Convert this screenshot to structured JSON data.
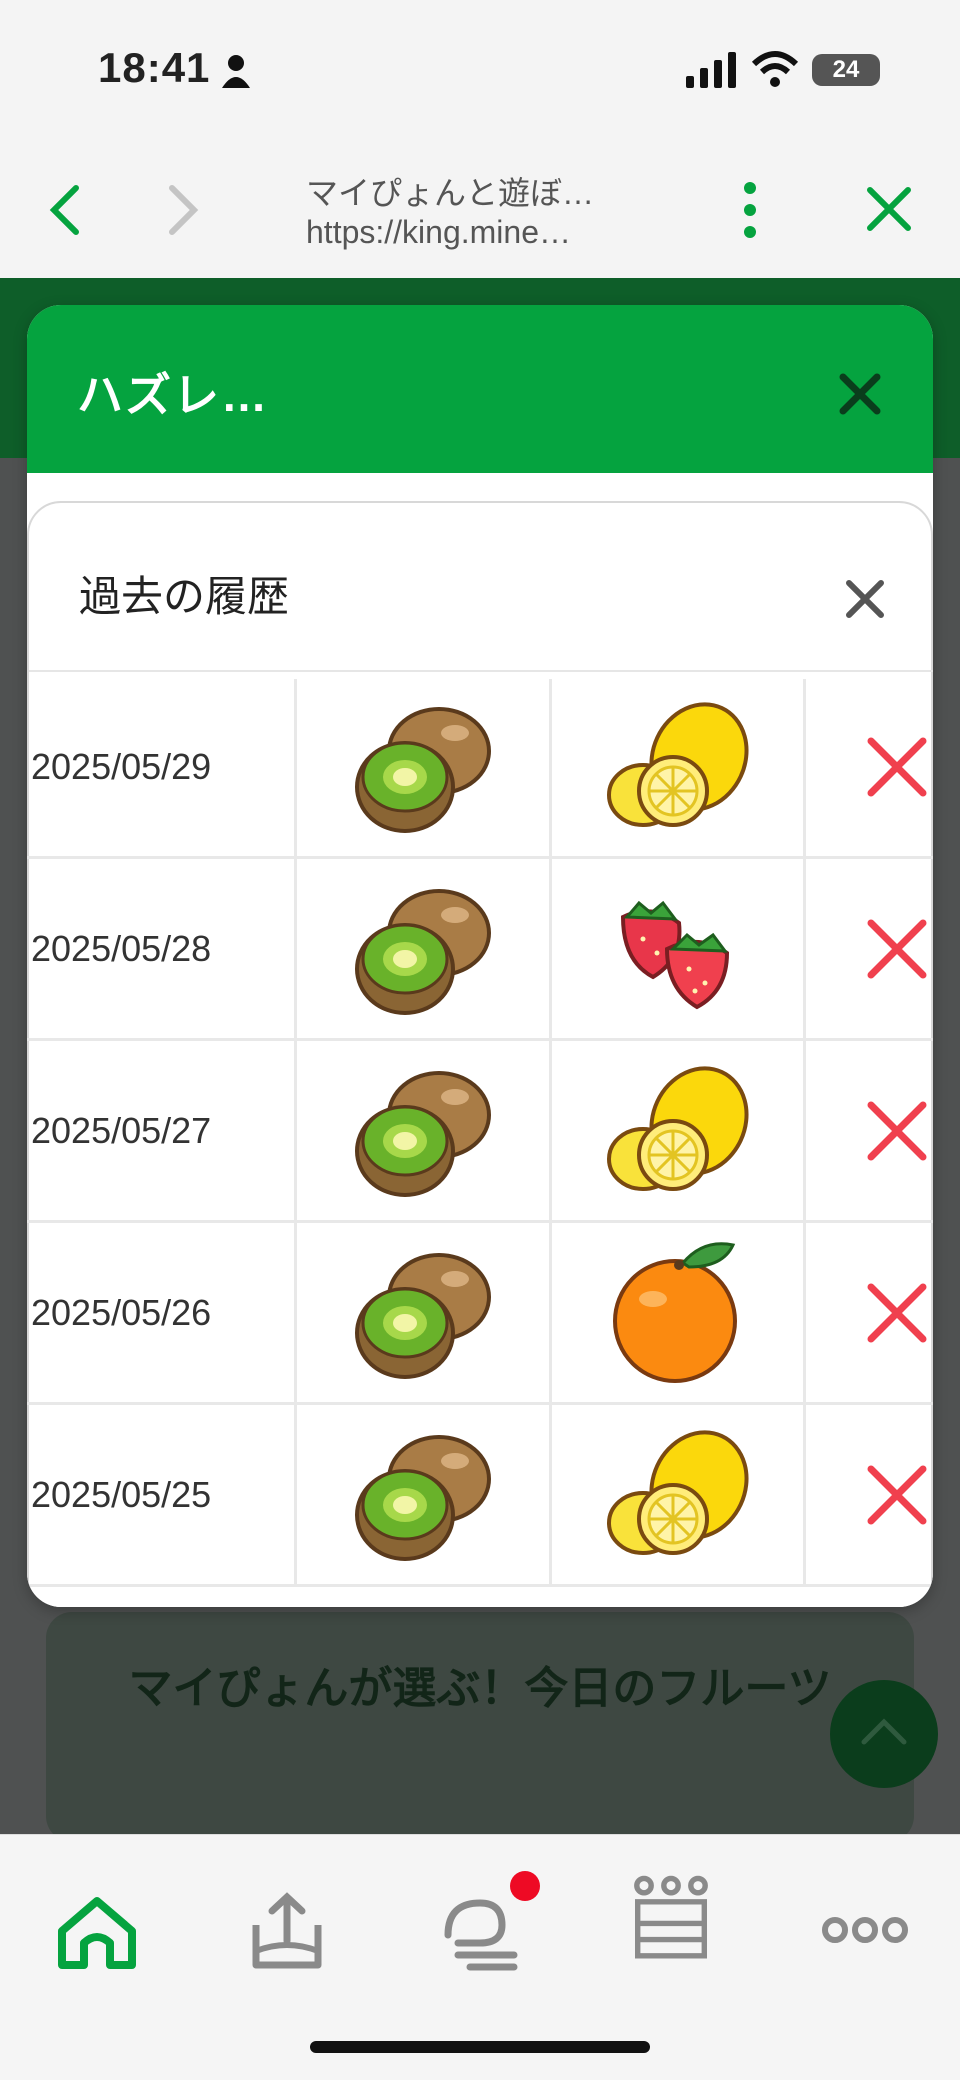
{
  "status_bar": {
    "time": "18:41",
    "battery": "24"
  },
  "browser": {
    "title": "マイぴょんと遊ぼ…",
    "url": "https://king.mine…"
  },
  "modal": {
    "title": "ハズレ…",
    "history_title": "過去の履歴"
  },
  "history": [
    {
      "date": "2025/05/29",
      "fruit1": "kiwi-icon",
      "fruit2": "lemon-icon",
      "result": "x-mark-icon"
    },
    {
      "date": "2025/05/28",
      "fruit1": "kiwi-icon",
      "fruit2": "strawberry-icon",
      "result": "x-mark-icon"
    },
    {
      "date": "2025/05/27",
      "fruit1": "kiwi-icon",
      "fruit2": "lemon-icon",
      "result": "x-mark-icon"
    },
    {
      "date": "2025/05/26",
      "fruit1": "kiwi-icon",
      "fruit2": "orange-icon",
      "result": "x-mark-icon"
    },
    {
      "date": "2025/05/25",
      "fruit1": "kiwi-icon",
      "fruit2": "lemon-icon",
      "result": "x-mark-icon"
    }
  ],
  "background_card": {
    "text": "マイぴょんが選ぶ！今日のフルーツ"
  },
  "bottom_nav": [
    "home-icon",
    "upload-icon",
    "chat-icon",
    "crown-icon",
    "more-icon"
  ],
  "colors": {
    "brand_green": "#05a33f",
    "miss_red": "#f0404e"
  }
}
